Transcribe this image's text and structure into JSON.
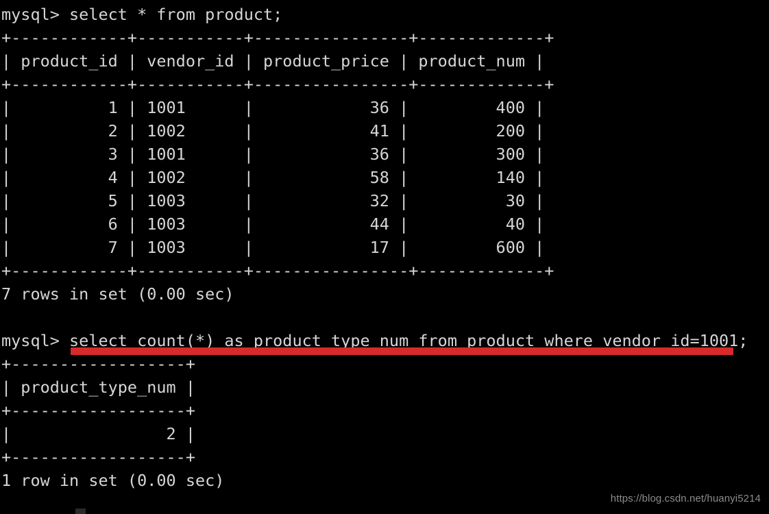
{
  "terminal": {
    "prompt": "mysql> ",
    "background_color": "#000000",
    "text_color": "#d6d6d6",
    "highlight_color": "#d82a2a"
  },
  "query1": {
    "prompt": "mysql> ",
    "sql": "select * from product;",
    "full_line": "mysql> select * from product;",
    "status": "7 rows in set (0.00 sec)",
    "separator": "+------------+-----------+----------------+-------------+",
    "header_row": "| product_id | vendor_id | product_price | product_num |",
    "columns": [
      "product_id",
      "vendor_id",
      "product_price",
      "product_num"
    ],
    "rows": [
      "|          1 | 1001      |            36 |         400 |",
      "|          2 | 1002      |            41 |         200 |",
      "|          3 | 1001      |            36 |         300 |",
      "|          4 | 1002      |            58 |         140 |",
      "|          5 | 1003      |            32 |          30 |",
      "|          6 | 1003      |            44 |          40 |",
      "|          7 | 1003      |            17 |         600 |"
    ],
    "data": [
      {
        "product_id": "1",
        "vendor_id": "1001",
        "product_price": "36",
        "product_num": "400"
      },
      {
        "product_id": "2",
        "vendor_id": "1002",
        "product_price": "41",
        "product_num": "200"
      },
      {
        "product_id": "3",
        "vendor_id": "1001",
        "product_price": "36",
        "product_num": "300"
      },
      {
        "product_id": "4",
        "vendor_id": "1002",
        "product_price": "58",
        "product_num": "140"
      },
      {
        "product_id": "5",
        "vendor_id": "1003",
        "product_price": "32",
        "product_num": "30"
      },
      {
        "product_id": "6",
        "vendor_id": "1003",
        "product_price": "44",
        "product_num": "40"
      },
      {
        "product_id": "7",
        "vendor_id": "1003",
        "product_price": "17",
        "product_num": "600"
      }
    ]
  },
  "blank_line": " ",
  "query2": {
    "prompt": "mysql> ",
    "sql": "select count(*) as product_type_num from product where vendor_id=1001;",
    "full_line": "mysql> select count(*) as product_type_num from product where vendor_id=1001;",
    "underlined": true,
    "status": "1 row in set (0.00 sec)",
    "separator": "+------------------+",
    "header_row": "| product_type_num |",
    "columns": [
      "product_type_num"
    ],
    "rows": [
      "|                2 |"
    ],
    "data": [
      {
        "product_type_num": "2"
      }
    ]
  },
  "watermark": {
    "text": "https://blog.csdn.net/huanyi5214"
  }
}
